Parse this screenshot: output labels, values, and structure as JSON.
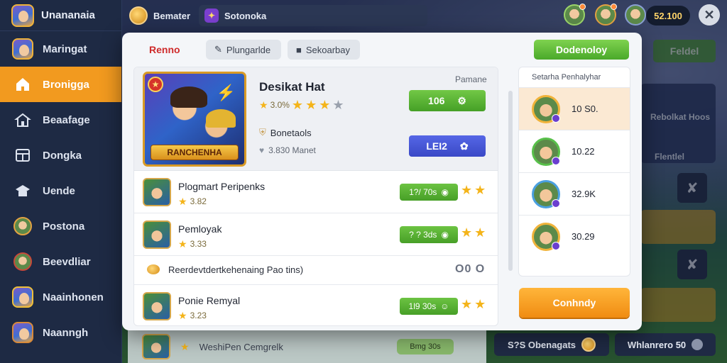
{
  "brand": {
    "name": "Unananaia"
  },
  "sidebar": {
    "items": [
      {
        "label": "Maringat",
        "icon": "avatar-icon",
        "active": false
      },
      {
        "label": "Bronigga",
        "icon": "home-icon",
        "active": true
      },
      {
        "label": "Beaafage",
        "icon": "house-icon",
        "active": false
      },
      {
        "label": "Dongka",
        "icon": "store-icon",
        "active": false
      },
      {
        "label": "Uende",
        "icon": "school-icon",
        "active": false
      },
      {
        "label": "Postona",
        "icon": "hero-icon",
        "active": false
      },
      {
        "label": "Beevdliar",
        "icon": "character-icon",
        "active": false
      },
      {
        "label": "Naainhonen",
        "icon": "trophy-hero-icon",
        "active": false
      },
      {
        "label": "Naanngh",
        "icon": "profile-icon",
        "active": false
      }
    ]
  },
  "topbar": {
    "coins_label": "Bemater",
    "search_label": "Sotonoka",
    "balance": "52.100"
  },
  "modal": {
    "title": "Renno",
    "tabs": [
      {
        "label": "Plungarlde",
        "icon": "pencil-icon"
      },
      {
        "label": "Sekoarbay",
        "icon": "square-icon"
      }
    ],
    "primary_button": "Dodenoloy",
    "feature": {
      "art_banner": "RANCHENHA",
      "title": "Desikat Hat",
      "rating_value": "3.0%",
      "stars_filled": 3,
      "stars_total": 4,
      "meta1": "Bonetaols",
      "meta2": "3.830 Manet",
      "label": "Pamane",
      "button_green": "106",
      "button_blue": "LEI2"
    },
    "rows": [
      {
        "title": "Plogmart Peripenks",
        "rating": "3.82",
        "pill": "1?/ 70s",
        "stars": 2
      },
      {
        "title": "Pemloyak",
        "rating": "3.33",
        "pill": "? ? 3ds",
        "stars": 2
      },
      {
        "title": "Ponie Remyal",
        "rating": "3.23",
        "pill": "1l9 30s",
        "stars": 2
      }
    ],
    "toggle_row": {
      "text": "Reerdevtdertkehenaing Pao tins)",
      "control": "O0 O"
    },
    "board": {
      "heading": "Setarha Penhalyhar",
      "rows": [
        {
          "value": "10 S0.",
          "highlight": true
        },
        {
          "value": "10.22",
          "highlight": false
        },
        {
          "value": "32.9K",
          "highlight": false
        },
        {
          "value": "30.29",
          "highlight": false
        }
      ]
    },
    "orange_button": "Conhndy"
  },
  "background": {
    "right_button": "Feldel",
    "card_caption1": "Rebolkat Hoos",
    "card_caption2": "Flentlel",
    "bottom_row_text": "WeshiPen Cemgrelk",
    "bottom_row_pill": "Bmg 30s",
    "chip_left": "S?S Obenagats",
    "chip_right": "Whlanrero 50"
  }
}
